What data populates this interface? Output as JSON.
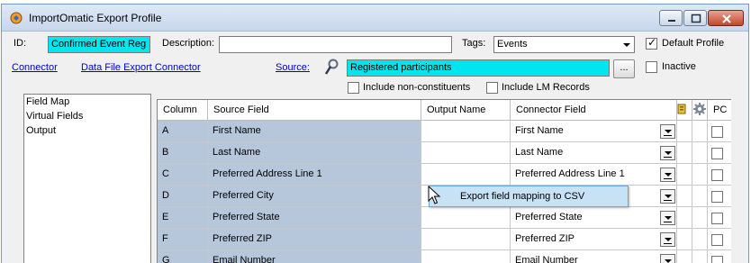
{
  "window": {
    "title": "ImportOmatic Export Profile"
  },
  "form": {
    "id_label": "ID:",
    "id_value": "Confirmed Event Reg",
    "description_label": "Description:",
    "description_value": "",
    "tags_label": "Tags:",
    "tags_value": "Events",
    "default_profile_label": "Default Profile",
    "default_profile_checked": true,
    "connector_link": "Connector",
    "data_file_link": "Data File Export Connector",
    "source_link": "Source:",
    "source_value": "Registered participants",
    "browse_label": "...",
    "inactive_label": "Inactive",
    "inactive_checked": false,
    "include_nonconstituents_label": "Include non-constituents",
    "include_lm_label": "Include LM Records"
  },
  "left_list": {
    "items": [
      "Field Map",
      "Virtual Fields",
      "Output"
    ]
  },
  "grid": {
    "headers": {
      "column": "Column",
      "source_field": "Source Field",
      "output_name": "Output Name",
      "connector_field": "Connector Field",
      "pc": "PC"
    },
    "rows": [
      {
        "column": "A",
        "source": "First Name",
        "output": "",
        "connector": "First Name"
      },
      {
        "column": "B",
        "source": "Last Name",
        "output": "",
        "connector": "Last Name"
      },
      {
        "column": "C",
        "source": "Preferred Address Line 1",
        "output": "",
        "connector": "Preferred Address Line 1"
      },
      {
        "column": "D",
        "source": "Preferred City",
        "output": "",
        "connector": ""
      },
      {
        "column": "E",
        "source": "Preferred State",
        "output": "",
        "connector": "Preferred State"
      },
      {
        "column": "F",
        "source": "Preferred ZIP",
        "output": "",
        "connector": "Preferred ZIP"
      },
      {
        "column": "G",
        "source": "Email Number",
        "output": "",
        "connector": "Email Number"
      }
    ]
  },
  "context_menu": {
    "item": "Export field mapping to CSV"
  },
  "colors": {
    "highlight_cyan": "#00e5ef",
    "selected_cell": "#b6c7db",
    "menu_hover": "#c7e1f5"
  }
}
